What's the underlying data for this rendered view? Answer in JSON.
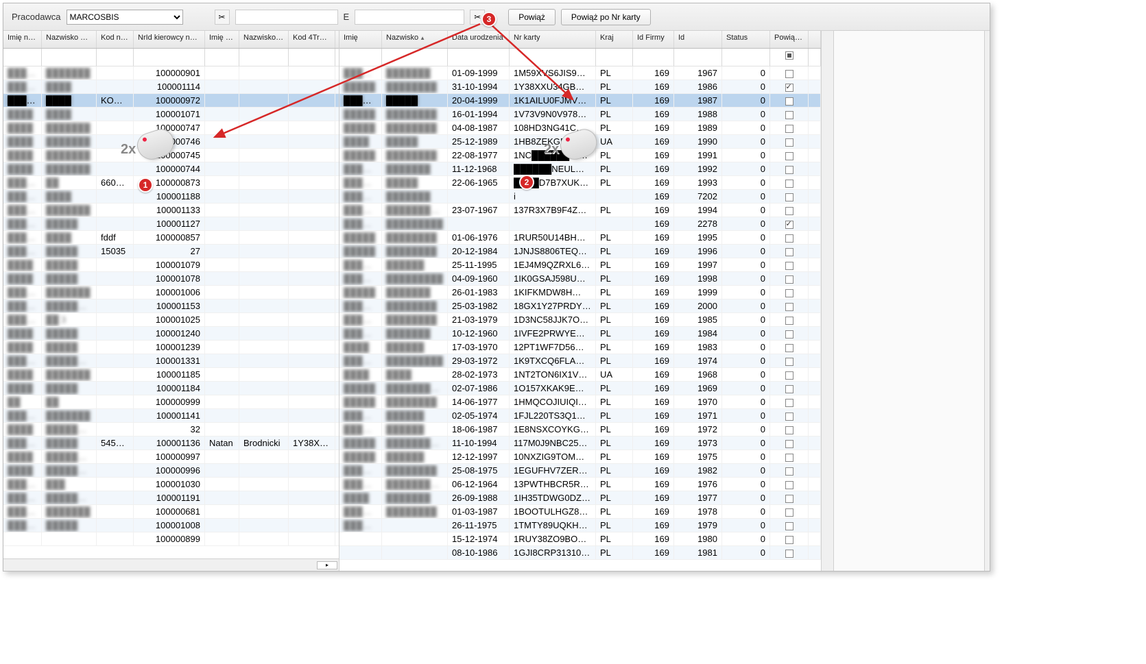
{
  "toolbar": {
    "employer_label": "Pracodawca",
    "employer_value": "MARCOSBIS",
    "field1_placeholder": "",
    "field2_label": "E",
    "field2_placeholder": "",
    "btn_link": "Powiąż",
    "btn_link_by_card": "Powiąż po Nr karty"
  },
  "left": {
    "columns": [
      "Imię n…",
      "Nazwisko naw",
      "Kod naw",
      "NrId kierowcy na…",
      "Imię 4Trans",
      "Nazwisko 4T…",
      "Kod 4Trans"
    ],
    "rows": [
      {
        "a": "█████",
        "b": "███████",
        "kod": "",
        "nrid": "100000901",
        "i4": "",
        "n4": "",
        "k4": ""
      },
      {
        "a": "█████",
        "b": "████",
        "kod": "",
        "nrid": "100001114",
        "i4": "",
        "n4": "",
        "k4": ""
      },
      {
        "a": "█████",
        "b": "████",
        "kod": "KOD…",
        "nrid": "100000972",
        "i4": "",
        "n4": "",
        "k4": "",
        "sel": true
      },
      {
        "a": "████",
        "b": "████",
        "kod": "",
        "nrid": "100001071",
        "i4": "",
        "n4": "",
        "k4": ""
      },
      {
        "a": "████",
        "b": "███████",
        "kod": "",
        "nrid": "100000747",
        "i4": "",
        "n4": "",
        "k4": ""
      },
      {
        "a": "████",
        "b": "███████",
        "kod": "",
        "nrid": "100000746",
        "i4": "",
        "n4": "",
        "k4": ""
      },
      {
        "a": "████",
        "b": "███████",
        "kod": "",
        "nrid": "100000745",
        "i4": "",
        "n4": "",
        "k4": ""
      },
      {
        "a": "████",
        "b": "███████",
        "kod": "",
        "nrid": "100000744",
        "i4": "",
        "n4": "",
        "k4": ""
      },
      {
        "a": "███████",
        "b": "██",
        "kod": "660…",
        "nrid": "100000873",
        "i4": "",
        "n4": "",
        "k4": ""
      },
      {
        "a": "█████",
        "b": "████",
        "kod": "",
        "nrid": "100001188",
        "i4": "",
        "n4": "",
        "k4": ""
      },
      {
        "a": "███████",
        "b": "███████",
        "kod": "",
        "nrid": "100001133",
        "i4": "",
        "n4": "",
        "k4": ""
      },
      {
        "a": "███████",
        "b": "█████",
        "kod": "",
        "nrid": "100001127",
        "i4": "",
        "n4": "",
        "k4": ""
      },
      {
        "a": "███████",
        "b": "████",
        "kod": "fddf",
        "nrid": "100000857",
        "i4": "",
        "n4": "",
        "k4": ""
      },
      {
        "a": "███████",
        "b": "█████",
        "kod": "15035",
        "nrid": "27",
        "i4": "",
        "n4": "",
        "k4": ""
      },
      {
        "a": "████",
        "b": "█████",
        "kod": "",
        "nrid": "100001079",
        "i4": "",
        "n4": "",
        "k4": ""
      },
      {
        "a": "████",
        "b": "█████",
        "kod": "",
        "nrid": "100001078",
        "i4": "",
        "n4": "",
        "k4": ""
      },
      {
        "a": "█████",
        "b": "███████",
        "kod": "",
        "nrid": "100001006",
        "i4": "",
        "n4": "",
        "k4": ""
      },
      {
        "a": "███████",
        "b": "████████",
        "kod": "",
        "nrid": "100001153",
        "i4": "",
        "n4": "",
        "k4": ""
      },
      {
        "a": "█████",
        "b": "██ 3",
        "kod": "",
        "nrid": "100001025",
        "i4": "",
        "n4": "",
        "k4": ""
      },
      {
        "a": "████",
        "b": "█████",
        "kod": "",
        "nrid": "100001240",
        "i4": "",
        "n4": "",
        "k4": ""
      },
      {
        "a": "████",
        "b": "█████",
        "kod": "",
        "nrid": "100001239",
        "i4": "",
        "n4": "",
        "k4": ""
      },
      {
        "a": "█████",
        "b": "████████",
        "kod": "",
        "nrid": "100001331",
        "i4": "",
        "n4": "",
        "k4": ""
      },
      {
        "a": "████",
        "b": "███████",
        "kod": "",
        "nrid": "100001185",
        "i4": "",
        "n4": "",
        "k4": ""
      },
      {
        "a": "████",
        "b": "█████",
        "kod": "",
        "nrid": "100001184",
        "i4": "",
        "n4": "",
        "k4": ""
      },
      {
        "a": "██",
        "b": "██",
        "kod": "",
        "nrid": "100000999",
        "i4": "",
        "n4": "",
        "k4": ""
      },
      {
        "a": "█████",
        "b": "███████",
        "kod": "",
        "nrid": "100001141",
        "i4": "",
        "n4": "",
        "k4": ""
      },
      {
        "a": "████",
        "b": "████████",
        "kod": "",
        "nrid": "32",
        "i4": "",
        "n4": "",
        "k4": ""
      },
      {
        "a": "█████",
        "b": "█████",
        "kod": "5454…",
        "nrid": "100001136",
        "i4": "Natan",
        "n4": "Brodnicki",
        "k4": "1Y38XXU"
      },
      {
        "a": "████",
        "b": "█████████",
        "kod": "",
        "nrid": "100000997",
        "i4": "",
        "n4": "",
        "k4": ""
      },
      {
        "a": "████",
        "b": "████████",
        "kod": "",
        "nrid": "100000996",
        "i4": "",
        "n4": "",
        "k4": ""
      },
      {
        "a": "█████",
        "b": "███",
        "kod": "",
        "nrid": "100001030",
        "i4": "",
        "n4": "",
        "k4": ""
      },
      {
        "a": "███████",
        "b": "████████",
        "kod": "",
        "nrid": "100001191",
        "i4": "",
        "n4": "",
        "k4": ""
      },
      {
        "a": "█████",
        "b": "███████",
        "kod": "",
        "nrid": "100000681",
        "i4": "",
        "n4": "",
        "k4": ""
      },
      {
        "a": "█████",
        "b": "█████",
        "kod": "",
        "nrid": "100001008",
        "i4": "",
        "n4": "",
        "k4": ""
      },
      {
        "a": "",
        "b": "",
        "kod": "",
        "nrid": "100000899",
        "i4": "",
        "n4": "",
        "k4": ""
      }
    ]
  },
  "right": {
    "columns": [
      "Imię",
      "Nazwisko",
      "Data urodzenia",
      "Nr karty",
      "Kraj",
      "Id Firmy",
      "Id",
      "Status",
      "Powiązany"
    ],
    "rows": [
      {
        "im": "███████",
        "nz": "███████",
        "du": "01-09-1999",
        "nk": "1M59XVS6JIS9…",
        "kr": "PL",
        "idf": "169",
        "id": "1967",
        "st": "0",
        "pw": false
      },
      {
        "im": "█████",
        "nz": "████████",
        "du": "31-10-1994",
        "nk": "1Y38XXU34GB…",
        "kr": "PL",
        "idf": "169",
        "id": "1986",
        "st": "0",
        "pw": true
      },
      {
        "im": "█████████",
        "nz": "█████",
        "du": "20-04-1999",
        "nk": "1K1AILU0FJMV…",
        "kr": "PL",
        "idf": "169",
        "id": "1987",
        "st": "0",
        "pw": false,
        "sel": true
      },
      {
        "im": "█████",
        "nz": "████████",
        "du": "16-01-1994",
        "nk": "1V73V9N0V978…",
        "kr": "PL",
        "idf": "169",
        "id": "1988",
        "st": "0",
        "pw": false
      },
      {
        "im": "█████",
        "nz": "████████",
        "du": "04-08-1987",
        "nk": "108HD3NG41C…",
        "kr": "PL",
        "idf": "169",
        "id": "1989",
        "st": "0",
        "pw": false
      },
      {
        "im": "████",
        "nz": "█████",
        "du": "25-12-1989",
        "nk": "1HB8ZEKGBT1…",
        "kr": "UA",
        "idf": "169",
        "id": "1990",
        "st": "0",
        "pw": false
      },
      {
        "im": "█████",
        "nz": "████████",
        "du": "22-08-1977",
        "nk": "1NC██████OI6…",
        "kr": "PL",
        "idf": "169",
        "id": "1991",
        "st": "0",
        "pw": false
      },
      {
        "im": "███████",
        "nz": "███████",
        "du": "11-12-1968",
        "nk": "██████NEUL…",
        "kr": "PL",
        "idf": "169",
        "id": "1992",
        "st": "0",
        "pw": false
      },
      {
        "im": "███████",
        "nz": "█████",
        "du": "22-06-1965",
        "nk": "████D7B7XUK…",
        "kr": "PL",
        "idf": "169",
        "id": "1993",
        "st": "0",
        "pw": false
      },
      {
        "im": "███████",
        "nz": "███████",
        "du": "",
        "nk": "i",
        "kr": "",
        "idf": "169",
        "id": "7202",
        "st": "0",
        "pw": false
      },
      {
        "im": "████████",
        "nz": "██████████",
        "du": "23-07-1967",
        "nk": "137R3X7B9F4Z…",
        "kr": "PL",
        "idf": "169",
        "id": "1994",
        "st": "0",
        "pw": false
      },
      {
        "im": "██████",
        "nz": "█████████",
        "du": "",
        "nk": "",
        "kr": "",
        "idf": "169",
        "id": "2278",
        "st": "0",
        "pw": true
      },
      {
        "im": "█████",
        "nz": "████████",
        "du": "01-06-1976",
        "nk": "1RUR50U14BH…",
        "kr": "PL",
        "idf": "169",
        "id": "1995",
        "st": "0",
        "pw": false
      },
      {
        "im": "█████",
        "nz": "████████",
        "du": "20-12-1984",
        "nk": "1JNJS8806TEQ…",
        "kr": "PL",
        "idf": "169",
        "id": "1996",
        "st": "0",
        "pw": false
      },
      {
        "im": "███████",
        "nz": "██████",
        "du": "25-11-1995",
        "nk": "1EJ4M9QZRXL6…",
        "kr": "PL",
        "idf": "169",
        "id": "1997",
        "st": "0",
        "pw": false
      },
      {
        "im": "███████",
        "nz": "█████████",
        "du": "04-09-1960",
        "nk": "1IK0GSAJ598U…",
        "kr": "PL",
        "idf": "169",
        "id": "1998",
        "st": "0",
        "pw": false
      },
      {
        "im": "█████",
        "nz": "███████",
        "du": "26-01-1983",
        "nk": "1KIFKMDW8H…",
        "kr": "PL",
        "idf": "169",
        "id": "1999",
        "st": "0",
        "pw": false
      },
      {
        "im": "████████",
        "nz": "████████",
        "du": "25-03-1982",
        "nk": "18GX1Y27PRDY…",
        "kr": "PL",
        "idf": "169",
        "id": "2000",
        "st": "0",
        "pw": false
      },
      {
        "im": "███████",
        "nz": "████████",
        "du": "21-03-1979",
        "nk": "1D3NC58JJK7O…",
        "kr": "PL",
        "idf": "169",
        "id": "1985",
        "st": "0",
        "pw": false
      },
      {
        "im": "███████",
        "nz": "███████",
        "du": "10-12-1960",
        "nk": "1IVFE2PRWYE…",
        "kr": "PL",
        "idf": "169",
        "id": "1984",
        "st": "0",
        "pw": false
      },
      {
        "im": "████",
        "nz": "██████",
        "du": "17-03-1970",
        "nk": "12PT1WF7D56…",
        "kr": "PL",
        "idf": "169",
        "id": "1983",
        "st": "0",
        "pw": false
      },
      {
        "im": "███████",
        "nz": "█████████",
        "du": "29-03-1972",
        "nk": "1K9TXCQ6FLA…",
        "kr": "PL",
        "idf": "169",
        "id": "1974",
        "st": "0",
        "pw": false
      },
      {
        "im": "████",
        "nz": "████",
        "du": "28-02-1973",
        "nk": "1NT2TON6IX1V…",
        "kr": "UA",
        "idf": "169",
        "id": "1968",
        "st": "0",
        "pw": false
      },
      {
        "im": "█████",
        "nz": "███████████",
        "du": "02-07-1986",
        "nk": "1O157XKAK9E…",
        "kr": "PL",
        "idf": "169",
        "id": "1969",
        "st": "0",
        "pw": false
      },
      {
        "im": "█████",
        "nz": "████████",
        "du": "14-06-1977",
        "nk": "1HMQCOJIUIQI0…",
        "kr": "PL",
        "idf": "169",
        "id": "1970",
        "st": "0",
        "pw": false
      },
      {
        "im": "██████",
        "nz": "██████",
        "du": "02-05-1974",
        "nk": "1FJL220TS3Q1…",
        "kr": "PL",
        "idf": "169",
        "id": "1971",
        "st": "0",
        "pw": false
      },
      {
        "im": "███████",
        "nz": "██████",
        "du": "18-06-1987",
        "nk": "1E8NSXCOYKG…",
        "kr": "PL",
        "idf": "169",
        "id": "1972",
        "st": "0",
        "pw": false
      },
      {
        "im": "█████",
        "nz": "███████████",
        "du": "11-10-1994",
        "nk": "117M0J9NBC25…",
        "kr": "PL",
        "idf": "169",
        "id": "1973",
        "st": "0",
        "pw": false
      },
      {
        "im": "█████",
        "nz": "██████",
        "du": "12-12-1997",
        "nk": "10NXZIG9TOMG…",
        "kr": "PL",
        "idf": "169",
        "id": "1975",
        "st": "0",
        "pw": false
      },
      {
        "im": "███████",
        "nz": "████████",
        "du": "25-08-1975",
        "nk": "1EGUFHV7ZER…",
        "kr": "PL",
        "idf": "169",
        "id": "1982",
        "st": "0",
        "pw": false
      },
      {
        "im": "████████",
        "nz": "███████████z",
        "du": "06-12-1964",
        "nk": "13PWTHBCR5R…",
        "kr": "PL",
        "idf": "169",
        "id": "1976",
        "st": "0",
        "pw": false
      },
      {
        "im": "████",
        "nz": "███████",
        "du": "26-09-1988",
        "nk": "1IH35TDWG0DZ…",
        "kr": "PL",
        "idf": "169",
        "id": "1977",
        "st": "0",
        "pw": false
      },
      {
        "im": "███████",
        "nz": "████████",
        "du": "01-03-1987",
        "nk": "1BOOTULHGZ8…",
        "kr": "PL",
        "idf": "169",
        "id": "1978",
        "st": "0",
        "pw": false
      },
      {
        "im": "███████",
        "nz": "",
        "du": "26-11-1975",
        "nk": "1TMTY89UQKH…",
        "kr": "PL",
        "idf": "169",
        "id": "1979",
        "st": "0",
        "pw": false
      },
      {
        "im": "",
        "nz": "",
        "du": "15-12-1974",
        "nk": "1RUY38ZO9BO2…",
        "kr": "PL",
        "idf": "169",
        "id": "1980",
        "st": "0",
        "pw": false
      },
      {
        "im": "",
        "nz": "",
        "du": "08-10-1986",
        "nk": "1GJI8CRP31310…",
        "kr": "PL",
        "idf": "169",
        "id": "1981",
        "st": "0",
        "pw": false
      }
    ]
  },
  "annotations": {
    "b1": "1",
    "b2": "2",
    "b3": "3",
    "dbl": "2x"
  }
}
